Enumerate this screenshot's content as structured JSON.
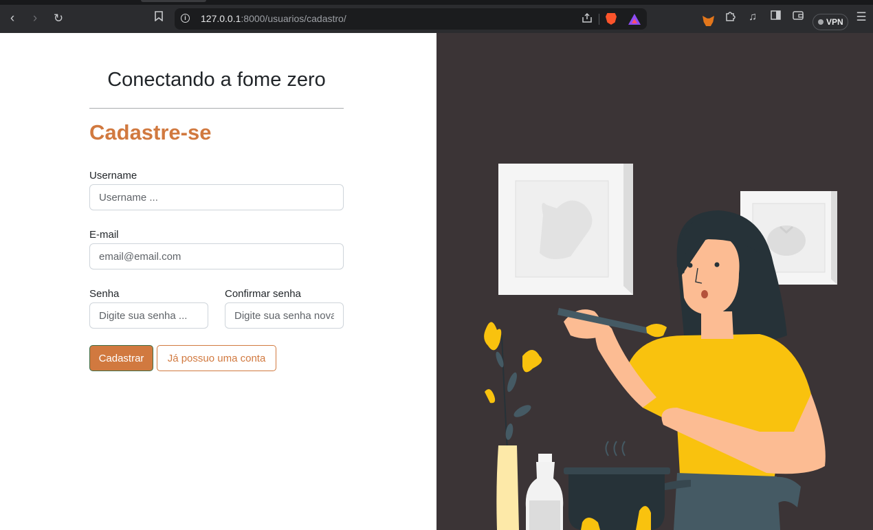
{
  "browser": {
    "url_host": "127.0.0.1",
    "url_path": ":8000/usuarios/cadastro/",
    "vpn_label": "VPN",
    "icons": {
      "back": "back-arrow-icon",
      "forward": "forward-arrow-icon",
      "reload": "reload-icon",
      "bookmark": "bookmark-icon",
      "site_info": "info-icon",
      "share": "share-icon",
      "brave": "brave-shield-icon",
      "rewards": "brave-rewards-icon",
      "metamask": "metamask-fox-icon",
      "extensions": "puzzle-icon",
      "media": "music-note-icon",
      "sidebar": "sidebar-icon",
      "wallet": "wallet-icon",
      "menu": "hamburger-menu-icon"
    }
  },
  "page": {
    "site_title": "Conectando a fome zero",
    "form_heading": "Cadastre-se",
    "fields": {
      "username": {
        "label": "Username",
        "placeholder": "Username ..."
      },
      "email": {
        "label": "E-mail",
        "placeholder": "email@email.com"
      },
      "password": {
        "label": "Senha",
        "placeholder": "Digite sua senha ..."
      },
      "confirm_password": {
        "label": "Confirmar senha",
        "placeholder": "Digite sua senha novamente ..."
      }
    },
    "buttons": {
      "submit": "Cadastrar",
      "has_account": "Já possuo uma conta"
    },
    "colors": {
      "accent": "#d1793f",
      "illustration_background": "#3b3436",
      "shirt": "#f9c20e"
    }
  }
}
